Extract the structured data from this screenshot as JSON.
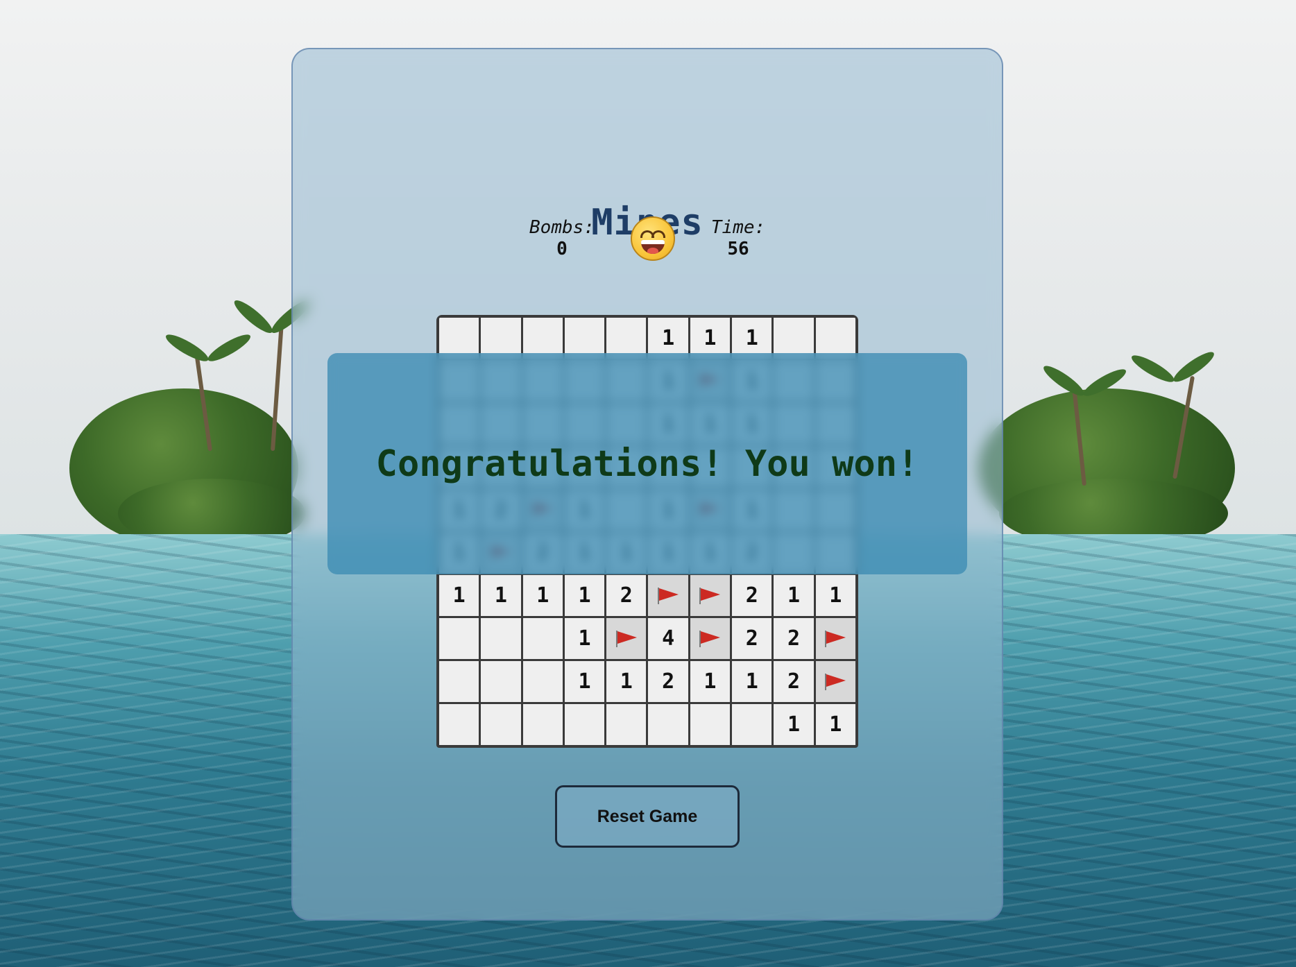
{
  "game": {
    "title": "Mines",
    "bombs_label": "Bombs:",
    "bombs_value": "0",
    "time_label": "Time:",
    "time_value": "56",
    "status_face": "grinning-face-icon",
    "message": "Congratulations! You won!",
    "reset_label": "Reset Game"
  },
  "board": {
    "rows": [
      [
        "",
        "",
        "",
        "",
        "",
        "1",
        "1",
        "1",
        "",
        ""
      ],
      [
        "",
        "",
        "",
        "",
        "",
        "1",
        "F",
        "1",
        "",
        ""
      ],
      [
        "",
        "",
        "",
        "",
        "",
        "1",
        "1",
        "1",
        "",
        ""
      ],
      [
        "",
        "",
        "",
        "",
        "",
        "",
        "",
        "",
        "",
        ""
      ],
      [
        "1",
        "2",
        "F",
        "1",
        "",
        "1",
        "F",
        "1",
        "",
        ""
      ],
      [
        "1",
        "F",
        "2",
        "1",
        "1",
        "1",
        "1",
        "2",
        "",
        ""
      ],
      [
        "1",
        "1",
        "1",
        "1",
        "2",
        "F",
        "F",
        "2",
        "1",
        "1"
      ],
      [
        "",
        "",
        "",
        "1",
        "F",
        "4",
        "F",
        "2",
        "2",
        "F"
      ],
      [
        "",
        "",
        "",
        "1",
        "1",
        "2",
        "1",
        "1",
        "2",
        "F"
      ],
      [
        "",
        "",
        "",
        "",
        "",
        "",
        "",
        "",
        "1",
        "1"
      ]
    ]
  },
  "colors": {
    "title": "#1e3d66",
    "message": "#0f3a18",
    "flag": "#cc2a22",
    "panel": "#96b9d2",
    "banner": "#3c8cb4"
  }
}
